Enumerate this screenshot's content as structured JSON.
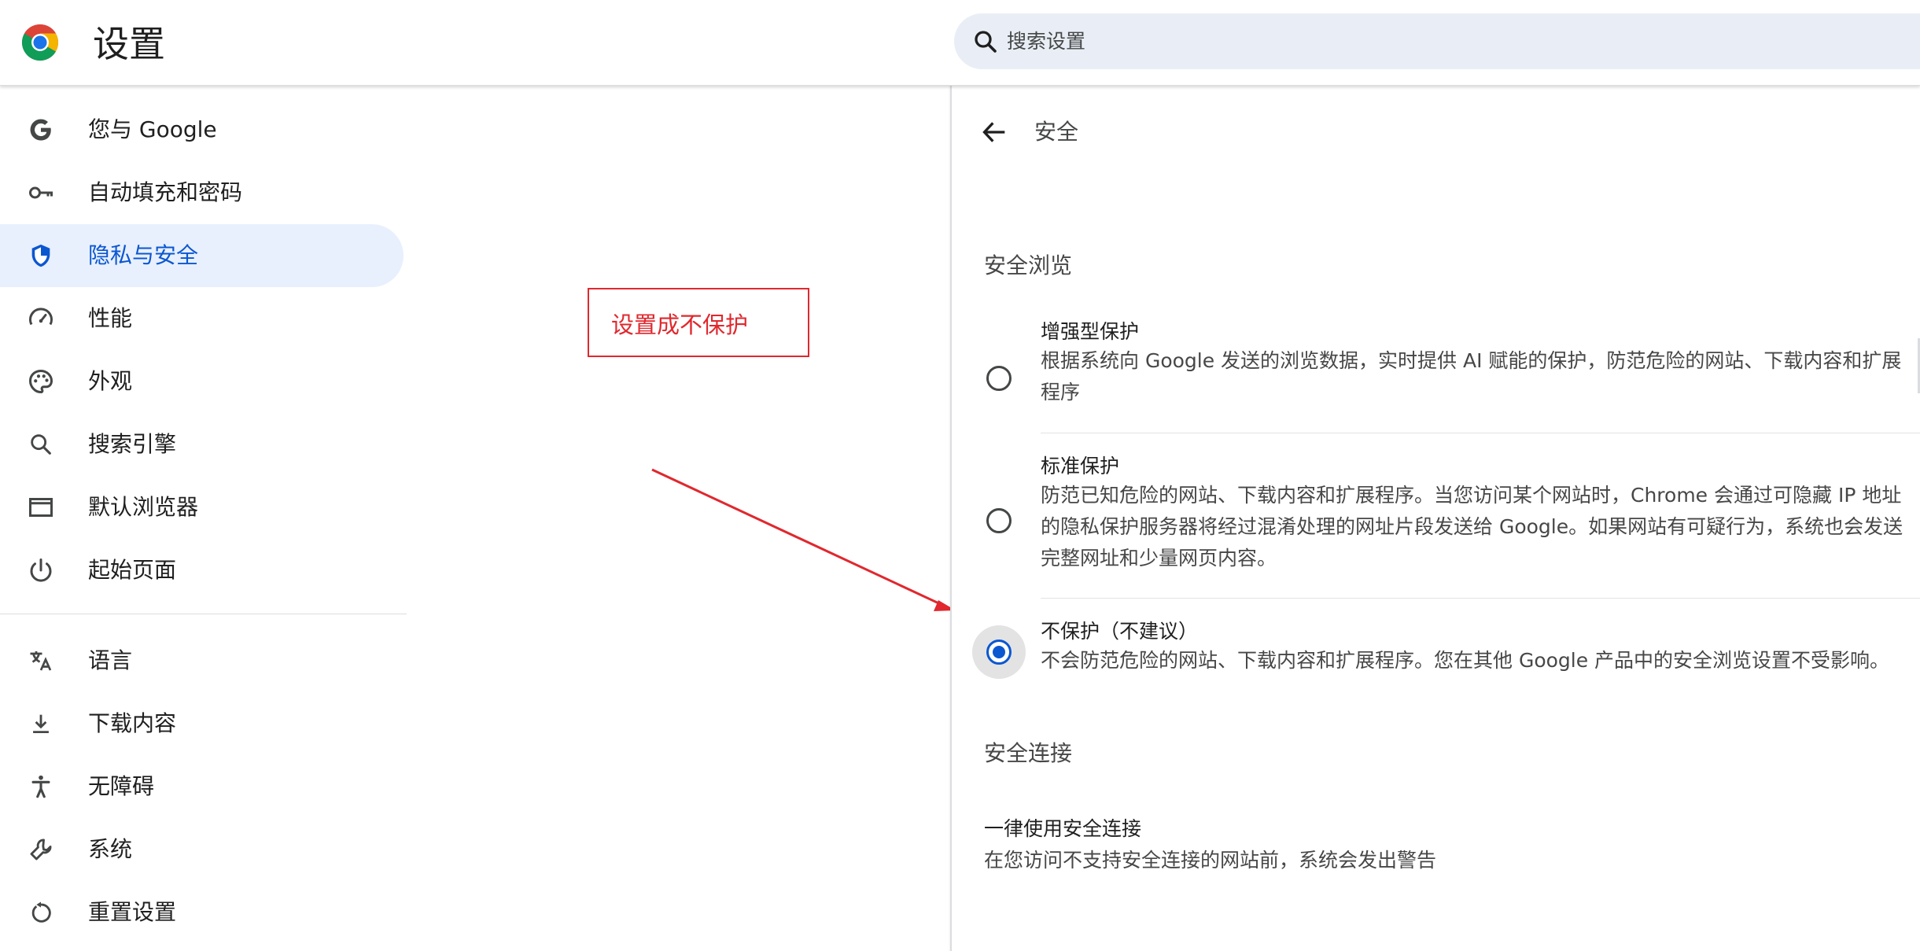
{
  "header": {
    "title": "设置",
    "search_placeholder": "搜索设置"
  },
  "sidebar": {
    "items": [
      {
        "label": "您与 Google",
        "icon": "google-g-icon"
      },
      {
        "label": "自动填充和密码",
        "icon": "key-icon"
      },
      {
        "label": "隐私与安全",
        "icon": "shield-icon",
        "active": true
      },
      {
        "label": "性能",
        "icon": "speedometer-icon"
      },
      {
        "label": "外观",
        "icon": "palette-icon"
      },
      {
        "label": "搜索引擎",
        "icon": "search-icon"
      },
      {
        "label": "默认浏览器",
        "icon": "browser-window-icon"
      },
      {
        "label": "起始页面",
        "icon": "power-icon"
      },
      {
        "label": "语言",
        "icon": "translate-icon"
      },
      {
        "label": "下载内容",
        "icon": "download-icon"
      },
      {
        "label": "无障碍",
        "icon": "accessibility-icon"
      },
      {
        "label": "系统",
        "icon": "wrench-icon"
      },
      {
        "label": "重置设置",
        "icon": "reset-icon"
      }
    ]
  },
  "annotation": {
    "text": "设置成不保护",
    "color": "#e0282e"
  },
  "panel": {
    "title": "安全",
    "safe_browsing": {
      "heading": "安全浏览",
      "options": [
        {
          "title": "增强型保护",
          "description": "根据系统向 Google 发送的浏览数据，实时提供 AI 赋能的保护，防范危险的网站、下载内容和扩展程序",
          "selected": false
        },
        {
          "title": "标准保护",
          "description": "防范已知危险的网站、下载内容和扩展程序。当您访问某个网站时，Chrome 会通过可隐藏 IP 地址的隐私保护服务器将经过混淆处理的网址片段发送给 Google。如果网站有可疑行为，系统也会发送完整网址和少量网页内容。",
          "selected": false
        },
        {
          "title": "不保护（不建议）",
          "description": "不会防范危险的网站、下载内容和扩展程序。您在其他 Google 产品中的安全浏览设置不受影响。",
          "selected": true
        }
      ]
    },
    "secure_connections": {
      "heading": "安全连接",
      "setting_title": "一律使用安全连接",
      "setting_description": "在您访问不支持安全连接的网站前，系统会发出警告"
    }
  },
  "colors": {
    "accent": "#0b57d0",
    "active_bg": "#e8f0fe",
    "search_bg": "#e9eef6"
  }
}
